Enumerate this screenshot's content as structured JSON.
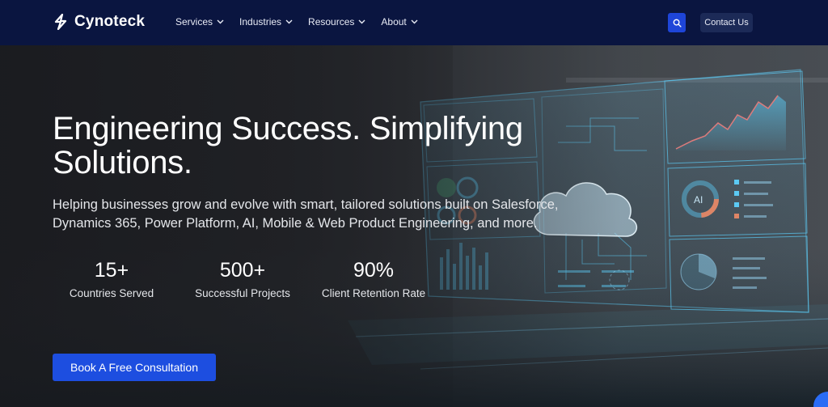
{
  "brand": {
    "name": "Cynoteck",
    "logo_icon": "bolt-s-icon"
  },
  "nav": {
    "items": [
      {
        "label": "Services"
      },
      {
        "label": "Industries"
      },
      {
        "label": "Resources"
      },
      {
        "label": "About"
      }
    ]
  },
  "header": {
    "search_icon": "search-icon",
    "contact_label": "Contact Us"
  },
  "hero": {
    "headline": "Engineering Success. Simplifying Solutions.",
    "subtext": "Helping businesses grow and evolve with smart, tailored solutions built on Salesforce, Dynamics 365, Power Platform, AI, Mobile & Web Product Engineering, and more.",
    "stats": [
      {
        "value": "15+",
        "label": "Countries Served"
      },
      {
        "value": "500+",
        "label": "Successful Projects"
      },
      {
        "value": "90%",
        "label": "Client Retention Rate"
      }
    ],
    "cta_label": "Book A Free Consultation",
    "art_text": {
      "ai_label": "AI"
    }
  },
  "colors": {
    "header_bg": "#0a1540",
    "accent_blue": "#1d4ee0",
    "contact_bg": "#1c2a57",
    "hologram_cyan": "#5fd3ff"
  }
}
